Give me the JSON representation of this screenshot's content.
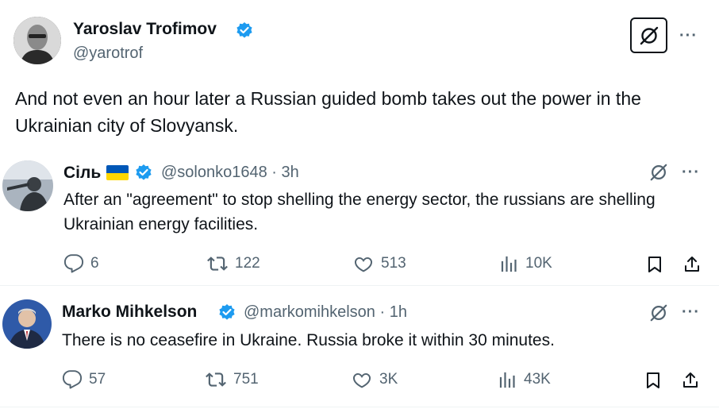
{
  "main_post": {
    "author_name": "Yaroslav Trofimov",
    "author_handle": "@yarotrof",
    "text": "And not even an hour later a Russian guided bomb takes out the power in the Ukrainian city of Slovyansk."
  },
  "quoted_posts": [
    {
      "author_name": "Сіль",
      "author_handle": "@solonko1648",
      "separator": "·",
      "time": "3h",
      "text": "After an \"agreement\" to stop shelling the energy sector, the russians are shelling Ukrainian energy facilities.",
      "replies": "6",
      "reposts": "122",
      "likes": "513",
      "views": "10K"
    },
    {
      "author_name": "Marko Mihkelson",
      "author_handle": "@markomihkelson",
      "separator": "·",
      "time": "1h",
      "text": "There is no ceasefire in Ukraine. Russia broke it within 30 minutes.",
      "replies": "57",
      "reposts": "751",
      "likes": "3K",
      "views": "43K"
    }
  ],
  "colors": {
    "verified_blue": "#1d9bf0",
    "text_primary": "#0f1419",
    "text_secondary": "#536471",
    "flag_blue": "#0057b7",
    "flag_yellow": "#ffd700"
  },
  "more_label": "···"
}
